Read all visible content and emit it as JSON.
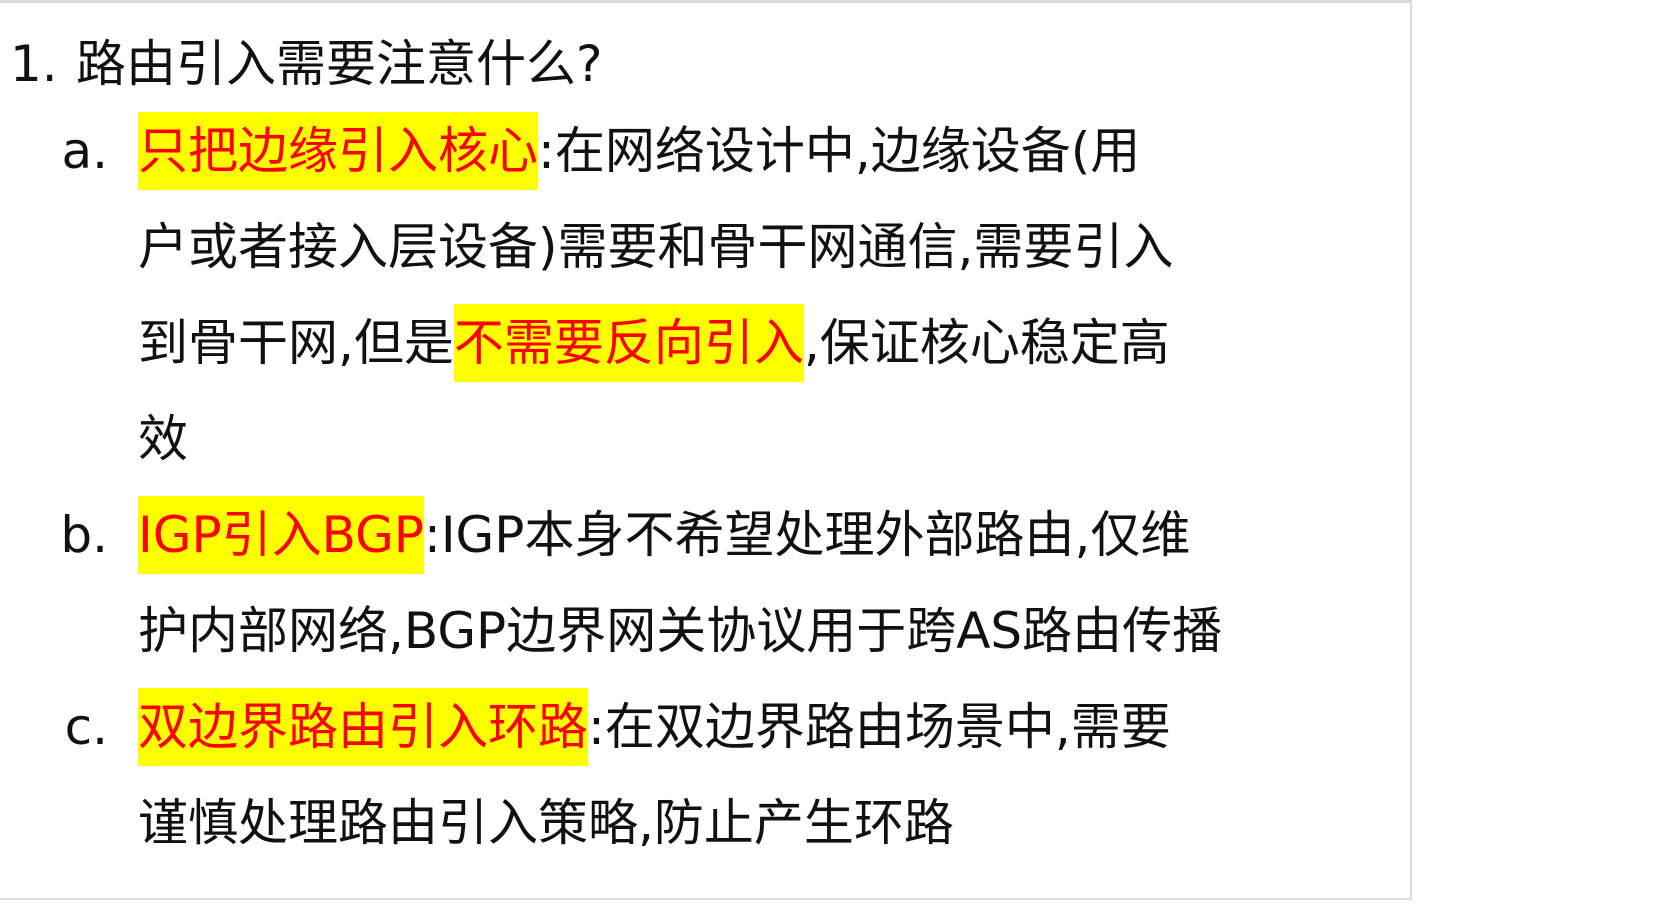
{
  "heading": {
    "number": "1.",
    "text": "路由引入需要注意什么?"
  },
  "items": [
    {
      "marker": "a.",
      "highlight": "只把边缘引入核心",
      "line1_rest": ":在网络设计中,边缘设备(用",
      "line2": "户或者接入层设备)需要和骨干网通信,需要引入",
      "line3_pre": "到骨干网,但是",
      "line3_highlight": "不需要反向引入",
      "line3_post": ",保证核心稳定高",
      "line4": "效"
    },
    {
      "marker": "b.",
      "highlight": "IGP引入BGP",
      "line1_rest": ":IGP本身不希望处理外部路由,仅维",
      "line2": "护内部网络,BGP边界网关协议用于跨AS路由传播"
    },
    {
      "marker": "c.",
      "highlight": "双边界路由引入环路",
      "line1_rest": ":在双边界路由场景中,需要",
      "line2": "谨慎处理路由引入策略,防止产生环路"
    }
  ],
  "colors": {
    "highlight_background": "#ffff00",
    "highlight_text": "#ff0000",
    "body_text": "#111111"
  }
}
